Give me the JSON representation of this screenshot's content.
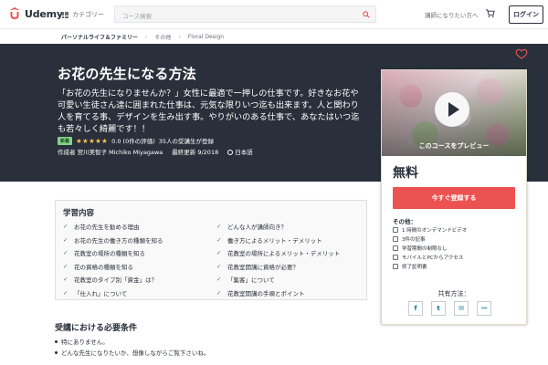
{
  "header": {
    "brand": "Udemy",
    "category_label": "カテゴリー",
    "search_placeholder": "コース検索",
    "instructor_link": "講師になりたい方へ",
    "login_label": "ログイン"
  },
  "breadcrumb": [
    "パーソナルライフ＆ファミリー",
    "その他",
    "Floral Design"
  ],
  "course": {
    "title": "お花の先生になる方法",
    "subtitle": "「お花の先生になりませんか？」女性に最適で一押しの仕事です。好きなお花や可愛い生徒さん達に囲まれた仕事は、元気な限りいつ迄も出来ます。人と関わり人を育てる事、デザインを生み出す事。やりがいのある仕事で、あなたはいつ迄も若々しく綺麗です！！",
    "badge": "新着",
    "stars": "★★★★★",
    "rating": "0.0 (0件の評価)",
    "students": "35人の受講生が登録",
    "author": "作成者 宮川美智子 Michiko Miyagawa",
    "updated": "最終更新 9/2018",
    "language": "日本語"
  },
  "sidebar": {
    "preview_label": "このコースをプレビュー",
    "price": "無料",
    "enroll_label": "今すぐ登録する",
    "includes_title": "その他：",
    "includes": [
      "1 時間のオンデマンドビデオ",
      "3件の記事",
      "学習期間の制限なし",
      "モバイルとPCからアクセス",
      "修了証明書"
    ],
    "share_title": "共有方法：",
    "share": [
      "f",
      "t",
      "✉",
      "⚯"
    ]
  },
  "learn": {
    "title": "学習内容",
    "items": [
      "お花の先生を勧める理由",
      "どんな人が講師向き？",
      "お花の先生の働き方の種類を知る",
      "働き方によるメリット・デメリット",
      "花教室の場所の種類を知る",
      "花教室の場所によるメリット・デメリット",
      "花の資格の種類を知る",
      "花教室開講に資格が必要？",
      "花教室のタイプ別「資金」は？",
      "「集客」について",
      "「仕入れ」について",
      "花教室開講の手順とポイント"
    ]
  },
  "requirements": {
    "title": "受講における必要条件",
    "items": [
      "特にありません。",
      "どんな先生になりたいか、想像しながらご覧下さいね。"
    ]
  }
}
